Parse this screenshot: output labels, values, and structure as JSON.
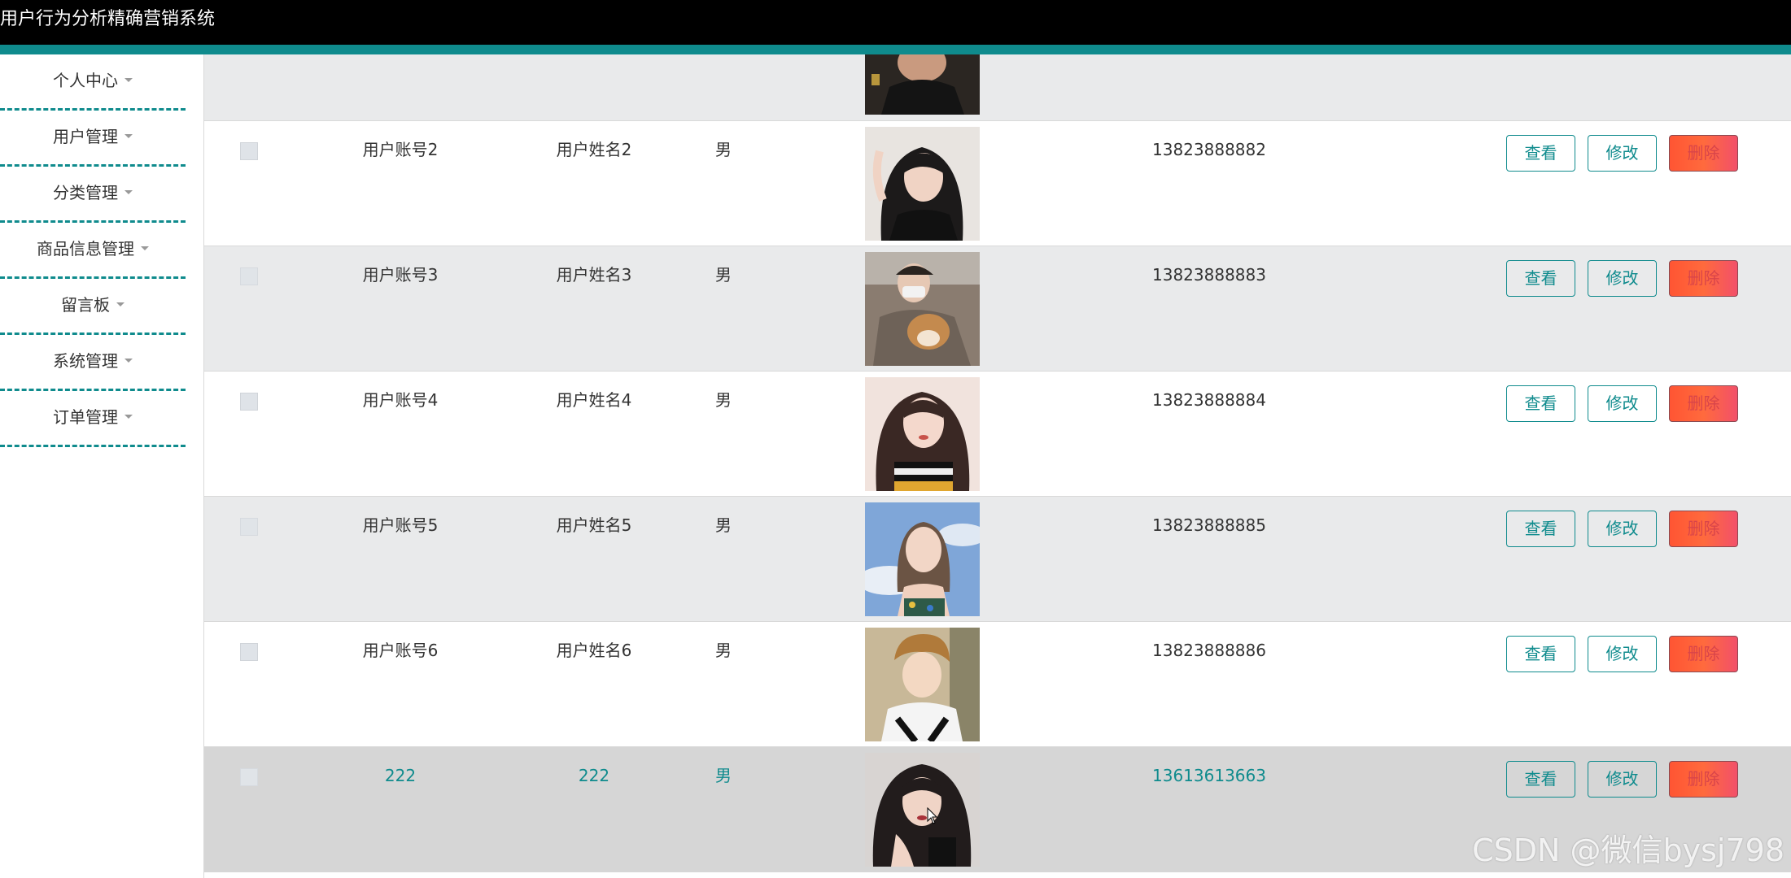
{
  "app": {
    "title": "用户行为分析精确营销系统"
  },
  "colors": {
    "accent": "#0f8b8d",
    "topbar": "#000000",
    "delete_button": "#ff5533"
  },
  "sidebar": {
    "items": [
      {
        "label": "个人中心",
        "icon": "chevron-down-icon"
      },
      {
        "label": "用户管理",
        "icon": "chevron-down-icon"
      },
      {
        "label": "分类管理",
        "icon": "chevron-down-icon"
      },
      {
        "label": "商品信息管理",
        "icon": "chevron-down-icon"
      },
      {
        "label": "留言板",
        "icon": "chevron-down-icon"
      },
      {
        "label": "系统管理",
        "icon": "chevron-down-icon"
      },
      {
        "label": "订单管理",
        "icon": "chevron-down-icon"
      }
    ]
  },
  "table": {
    "actions": {
      "view": "查看",
      "edit": "修改",
      "delete": "删除"
    },
    "rows": [
      {
        "account": "用户账号2",
        "name": "用户姓名2",
        "sex": "男",
        "phone": "13823888882",
        "avatar": "user-photo"
      },
      {
        "account": "用户账号3",
        "name": "用户姓名3",
        "sex": "男",
        "phone": "13823888883",
        "avatar": "user-photo"
      },
      {
        "account": "用户账号4",
        "name": "用户姓名4",
        "sex": "男",
        "phone": "13823888884",
        "avatar": "user-photo"
      },
      {
        "account": "用户账号5",
        "name": "用户姓名5",
        "sex": "男",
        "phone": "13823888885",
        "avatar": "user-photo"
      },
      {
        "account": "用户账号6",
        "name": "用户姓名6",
        "sex": "男",
        "phone": "13823888886",
        "avatar": "user-photo"
      },
      {
        "account": "222",
        "name": "222",
        "sex": "男",
        "phone": "13613613663",
        "avatar": "user-photo"
      }
    ]
  },
  "watermark": "CSDN @微信bysj798"
}
